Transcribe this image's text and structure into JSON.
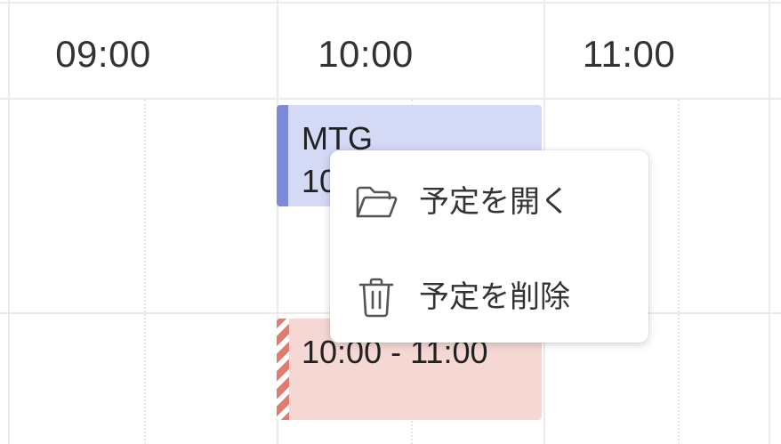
{
  "header": {
    "times": [
      "09:00",
      "10:00",
      "11:00"
    ]
  },
  "events": [
    {
      "title": "MTG",
      "time": "10"
    },
    {
      "title": "",
      "time": "10:00 - 11:00"
    }
  ],
  "context_menu": {
    "items": [
      {
        "label": "予定を開く",
        "icon": "folder-open-icon"
      },
      {
        "label": "予定を削除",
        "icon": "trash-icon"
      }
    ]
  },
  "colors": {
    "event_blue_bg": "#d4d9f5",
    "event_blue_bar": "#7b8ad9",
    "event_red_bg": "#f5d7d3",
    "event_red_bar": "#df7c6f"
  }
}
